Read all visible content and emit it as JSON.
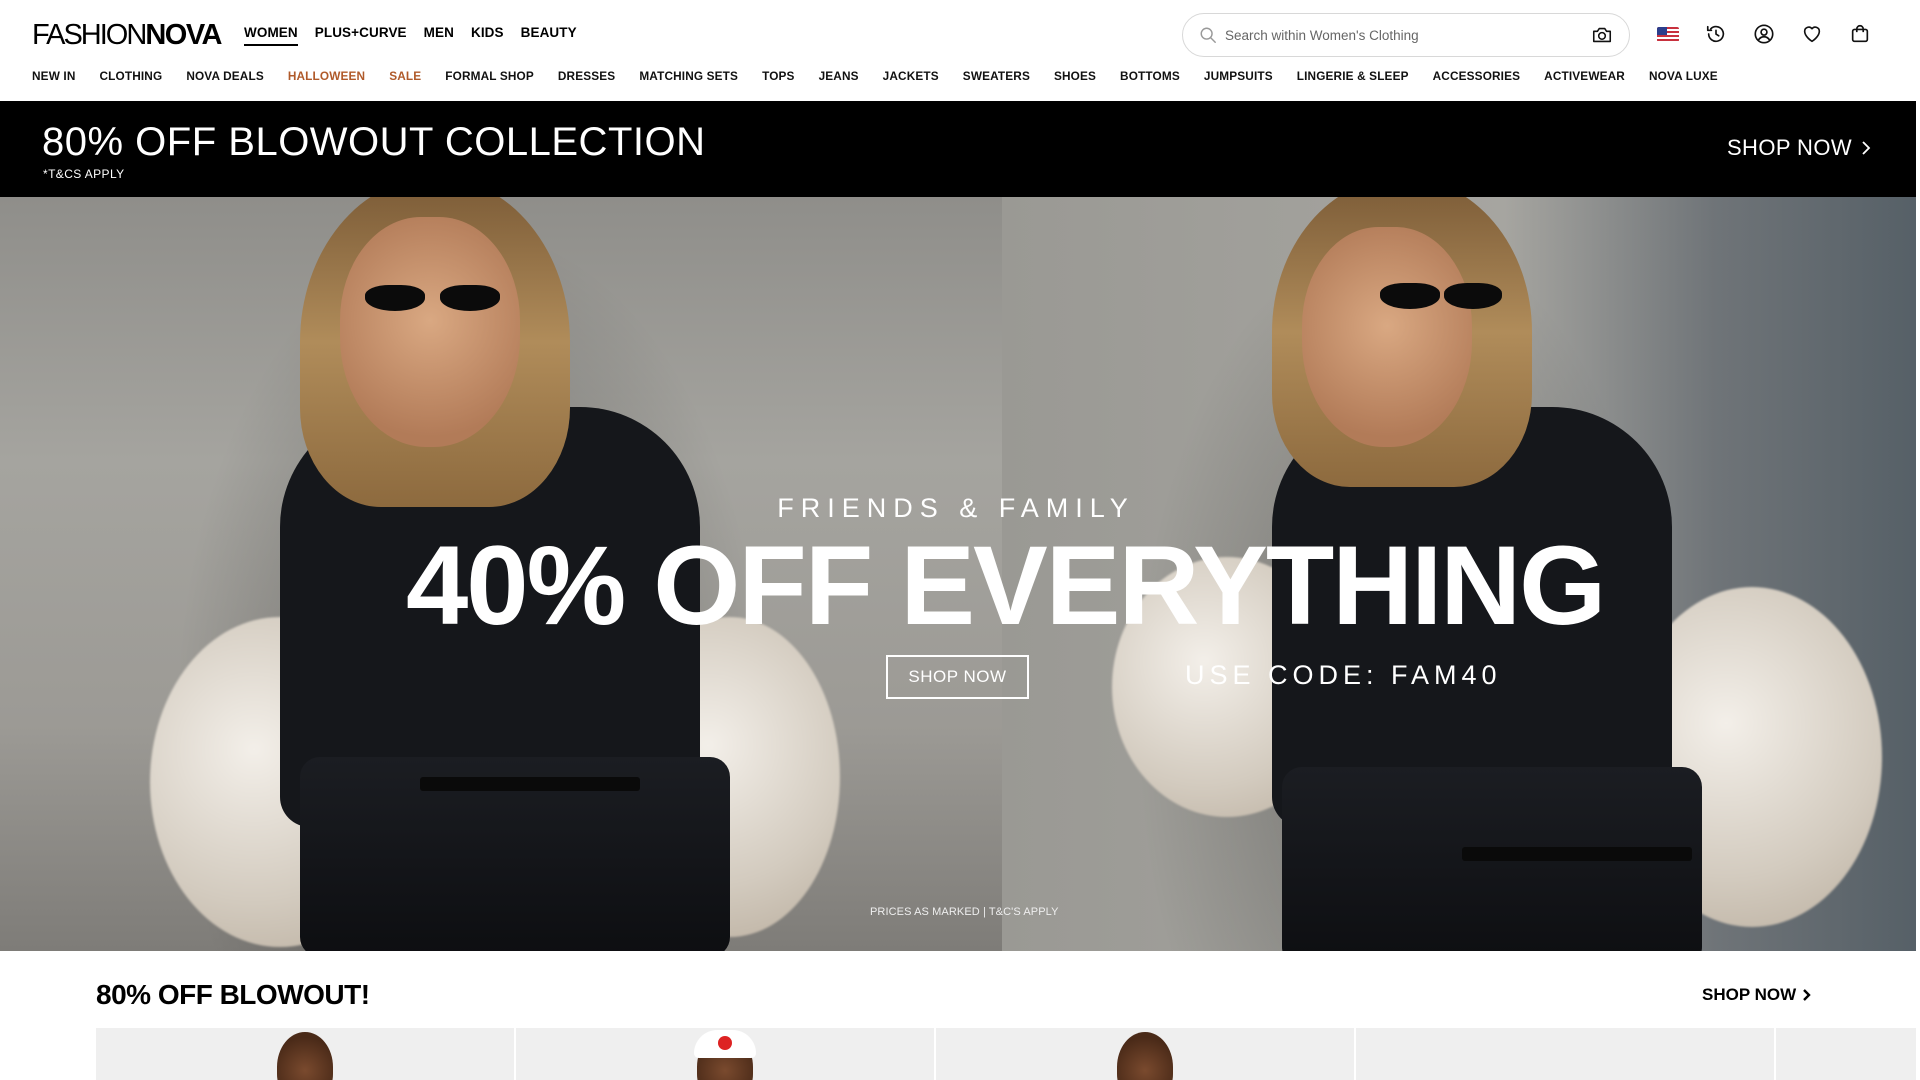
{
  "brand": {
    "logo_thin": "FASHION",
    "logo_bold": "NOVA"
  },
  "top_nav": [
    {
      "label": "WOMEN",
      "active": true
    },
    {
      "label": "PLUS+CURVE",
      "active": false
    },
    {
      "label": "MEN",
      "active": false
    },
    {
      "label": "KIDS",
      "active": false
    },
    {
      "label": "BEAUTY",
      "active": false
    }
  ],
  "search": {
    "placeholder": "Search within Women's Clothing"
  },
  "header_icons": [
    "us-flag-icon",
    "history-icon",
    "account-icon",
    "heart-icon",
    "bag-icon"
  ],
  "categories": [
    "NEW IN",
    "CLOTHING",
    "NOVA DEALS",
    "HALLOWEEN",
    "SALE",
    "FORMAL SHOP",
    "DRESSES",
    "MATCHING SETS",
    "TOPS",
    "JEANS",
    "JACKETS",
    "SWEATERS",
    "SHOES",
    "BOTTOMS",
    "JUMPSUITS",
    "LINGERIE & SLEEP",
    "ACCESSORIES",
    "ACTIVEWEAR",
    "NOVA LUXE"
  ],
  "category_accent_color": "#b05a2a",
  "promo": {
    "title": "80% OFF BLOWOUT COLLECTION",
    "sub": "*T&CS APPLY",
    "cta": "SHOP NOW"
  },
  "hero": {
    "kicker": "FRIENDS & FAMILY",
    "title": "40% OFF EVERYTHING",
    "button": "SHOP NOW",
    "code": "USE CODE: FAM40",
    "fine_print": "PRICES AS MARKED | T&C'S APPLY"
  },
  "section": {
    "title": "80% OFF BLOWOUT!",
    "cta": "SHOP NOW"
  }
}
